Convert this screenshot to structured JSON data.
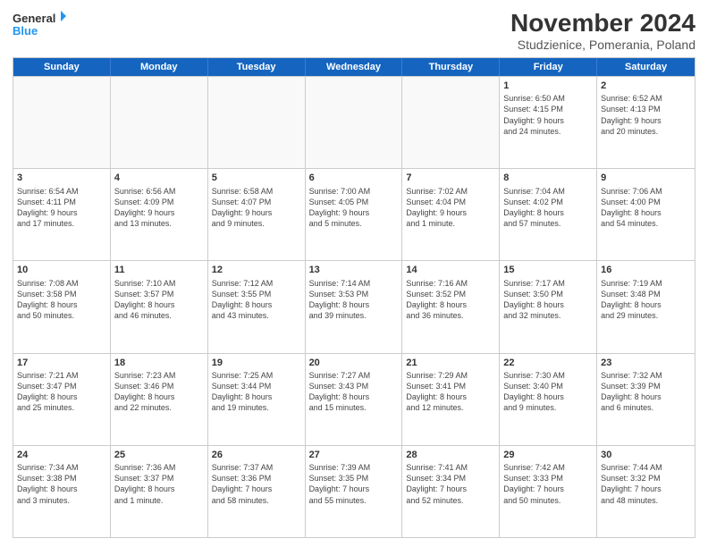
{
  "header": {
    "logo_line1": "General",
    "logo_line2": "Blue",
    "month_title": "November 2024",
    "subtitle": "Studzienice, Pomerania, Poland"
  },
  "weekdays": [
    "Sunday",
    "Monday",
    "Tuesday",
    "Wednesday",
    "Thursday",
    "Friday",
    "Saturday"
  ],
  "rows": [
    [
      {
        "day": "",
        "detail": "",
        "empty": true
      },
      {
        "day": "",
        "detail": "",
        "empty": true
      },
      {
        "day": "",
        "detail": "",
        "empty": true
      },
      {
        "day": "",
        "detail": "",
        "empty": true
      },
      {
        "day": "",
        "detail": "",
        "empty": true
      },
      {
        "day": "1",
        "detail": "Sunrise: 6:50 AM\nSunset: 4:15 PM\nDaylight: 9 hours\nand 24 minutes."
      },
      {
        "day": "2",
        "detail": "Sunrise: 6:52 AM\nSunset: 4:13 PM\nDaylight: 9 hours\nand 20 minutes."
      }
    ],
    [
      {
        "day": "3",
        "detail": "Sunrise: 6:54 AM\nSunset: 4:11 PM\nDaylight: 9 hours\nand 17 minutes."
      },
      {
        "day": "4",
        "detail": "Sunrise: 6:56 AM\nSunset: 4:09 PM\nDaylight: 9 hours\nand 13 minutes."
      },
      {
        "day": "5",
        "detail": "Sunrise: 6:58 AM\nSunset: 4:07 PM\nDaylight: 9 hours\nand 9 minutes."
      },
      {
        "day": "6",
        "detail": "Sunrise: 7:00 AM\nSunset: 4:05 PM\nDaylight: 9 hours\nand 5 minutes."
      },
      {
        "day": "7",
        "detail": "Sunrise: 7:02 AM\nSunset: 4:04 PM\nDaylight: 9 hours\nand 1 minute."
      },
      {
        "day": "8",
        "detail": "Sunrise: 7:04 AM\nSunset: 4:02 PM\nDaylight: 8 hours\nand 57 minutes."
      },
      {
        "day": "9",
        "detail": "Sunrise: 7:06 AM\nSunset: 4:00 PM\nDaylight: 8 hours\nand 54 minutes."
      }
    ],
    [
      {
        "day": "10",
        "detail": "Sunrise: 7:08 AM\nSunset: 3:58 PM\nDaylight: 8 hours\nand 50 minutes."
      },
      {
        "day": "11",
        "detail": "Sunrise: 7:10 AM\nSunset: 3:57 PM\nDaylight: 8 hours\nand 46 minutes."
      },
      {
        "day": "12",
        "detail": "Sunrise: 7:12 AM\nSunset: 3:55 PM\nDaylight: 8 hours\nand 43 minutes."
      },
      {
        "day": "13",
        "detail": "Sunrise: 7:14 AM\nSunset: 3:53 PM\nDaylight: 8 hours\nand 39 minutes."
      },
      {
        "day": "14",
        "detail": "Sunrise: 7:16 AM\nSunset: 3:52 PM\nDaylight: 8 hours\nand 36 minutes."
      },
      {
        "day": "15",
        "detail": "Sunrise: 7:17 AM\nSunset: 3:50 PM\nDaylight: 8 hours\nand 32 minutes."
      },
      {
        "day": "16",
        "detail": "Sunrise: 7:19 AM\nSunset: 3:48 PM\nDaylight: 8 hours\nand 29 minutes."
      }
    ],
    [
      {
        "day": "17",
        "detail": "Sunrise: 7:21 AM\nSunset: 3:47 PM\nDaylight: 8 hours\nand 25 minutes."
      },
      {
        "day": "18",
        "detail": "Sunrise: 7:23 AM\nSunset: 3:46 PM\nDaylight: 8 hours\nand 22 minutes."
      },
      {
        "day": "19",
        "detail": "Sunrise: 7:25 AM\nSunset: 3:44 PM\nDaylight: 8 hours\nand 19 minutes."
      },
      {
        "day": "20",
        "detail": "Sunrise: 7:27 AM\nSunset: 3:43 PM\nDaylight: 8 hours\nand 15 minutes."
      },
      {
        "day": "21",
        "detail": "Sunrise: 7:29 AM\nSunset: 3:41 PM\nDaylight: 8 hours\nand 12 minutes."
      },
      {
        "day": "22",
        "detail": "Sunrise: 7:30 AM\nSunset: 3:40 PM\nDaylight: 8 hours\nand 9 minutes."
      },
      {
        "day": "23",
        "detail": "Sunrise: 7:32 AM\nSunset: 3:39 PM\nDaylight: 8 hours\nand 6 minutes."
      }
    ],
    [
      {
        "day": "24",
        "detail": "Sunrise: 7:34 AM\nSunset: 3:38 PM\nDaylight: 8 hours\nand 3 minutes."
      },
      {
        "day": "25",
        "detail": "Sunrise: 7:36 AM\nSunset: 3:37 PM\nDaylight: 8 hours\nand 1 minute."
      },
      {
        "day": "26",
        "detail": "Sunrise: 7:37 AM\nSunset: 3:36 PM\nDaylight: 7 hours\nand 58 minutes."
      },
      {
        "day": "27",
        "detail": "Sunrise: 7:39 AM\nSunset: 3:35 PM\nDaylight: 7 hours\nand 55 minutes."
      },
      {
        "day": "28",
        "detail": "Sunrise: 7:41 AM\nSunset: 3:34 PM\nDaylight: 7 hours\nand 52 minutes."
      },
      {
        "day": "29",
        "detail": "Sunrise: 7:42 AM\nSunset: 3:33 PM\nDaylight: 7 hours\nand 50 minutes."
      },
      {
        "day": "30",
        "detail": "Sunrise: 7:44 AM\nSunset: 3:32 PM\nDaylight: 7 hours\nand 48 minutes."
      }
    ]
  ]
}
